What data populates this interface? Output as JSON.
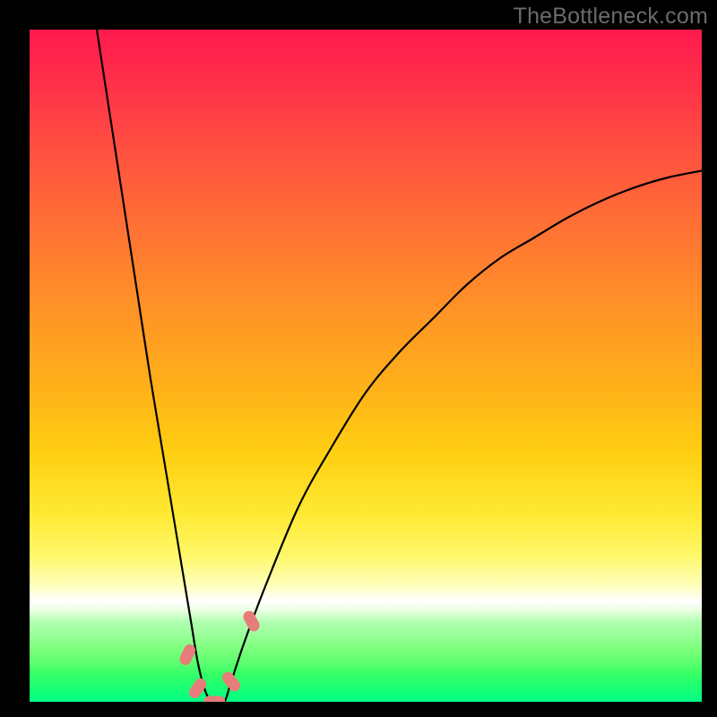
{
  "watermark": "TheBottleneck.com",
  "colors": {
    "curve": "#000000",
    "marker_fill": "#e77d7a",
    "marker_stroke": "#cc5e57"
  },
  "chart_data": {
    "type": "line",
    "title": "",
    "xlabel": "",
    "ylabel": "",
    "xlim": [
      0,
      100
    ],
    "ylim": [
      0,
      100
    ],
    "grid": false,
    "series": [
      {
        "name": "bottleneck-curve",
        "x": [
          10,
          12,
          14,
          16,
          18,
          20,
          22,
          24,
          25,
          26,
          27,
          28,
          29,
          30,
          32,
          35,
          40,
          45,
          50,
          55,
          60,
          65,
          70,
          75,
          80,
          85,
          90,
          95,
          100
        ],
        "y": [
          100,
          87,
          74,
          61,
          48,
          36,
          24,
          12,
          6,
          2,
          0,
          0,
          0,
          3,
          9,
          17,
          29,
          38,
          46,
          52,
          57,
          62,
          66,
          69,
          72,
          74.5,
          76.5,
          78,
          79
        ]
      }
    ],
    "annotations": {
      "markers": [
        {
          "x": 23.5,
          "y": 7,
          "angle": -65
        },
        {
          "x": 25.0,
          "y": 2,
          "angle": -55
        },
        {
          "x": 27.5,
          "y": 0,
          "angle": 0
        },
        {
          "x": 30.0,
          "y": 3,
          "angle": 50
        },
        {
          "x": 33.0,
          "y": 12,
          "angle": 62
        }
      ]
    }
  }
}
